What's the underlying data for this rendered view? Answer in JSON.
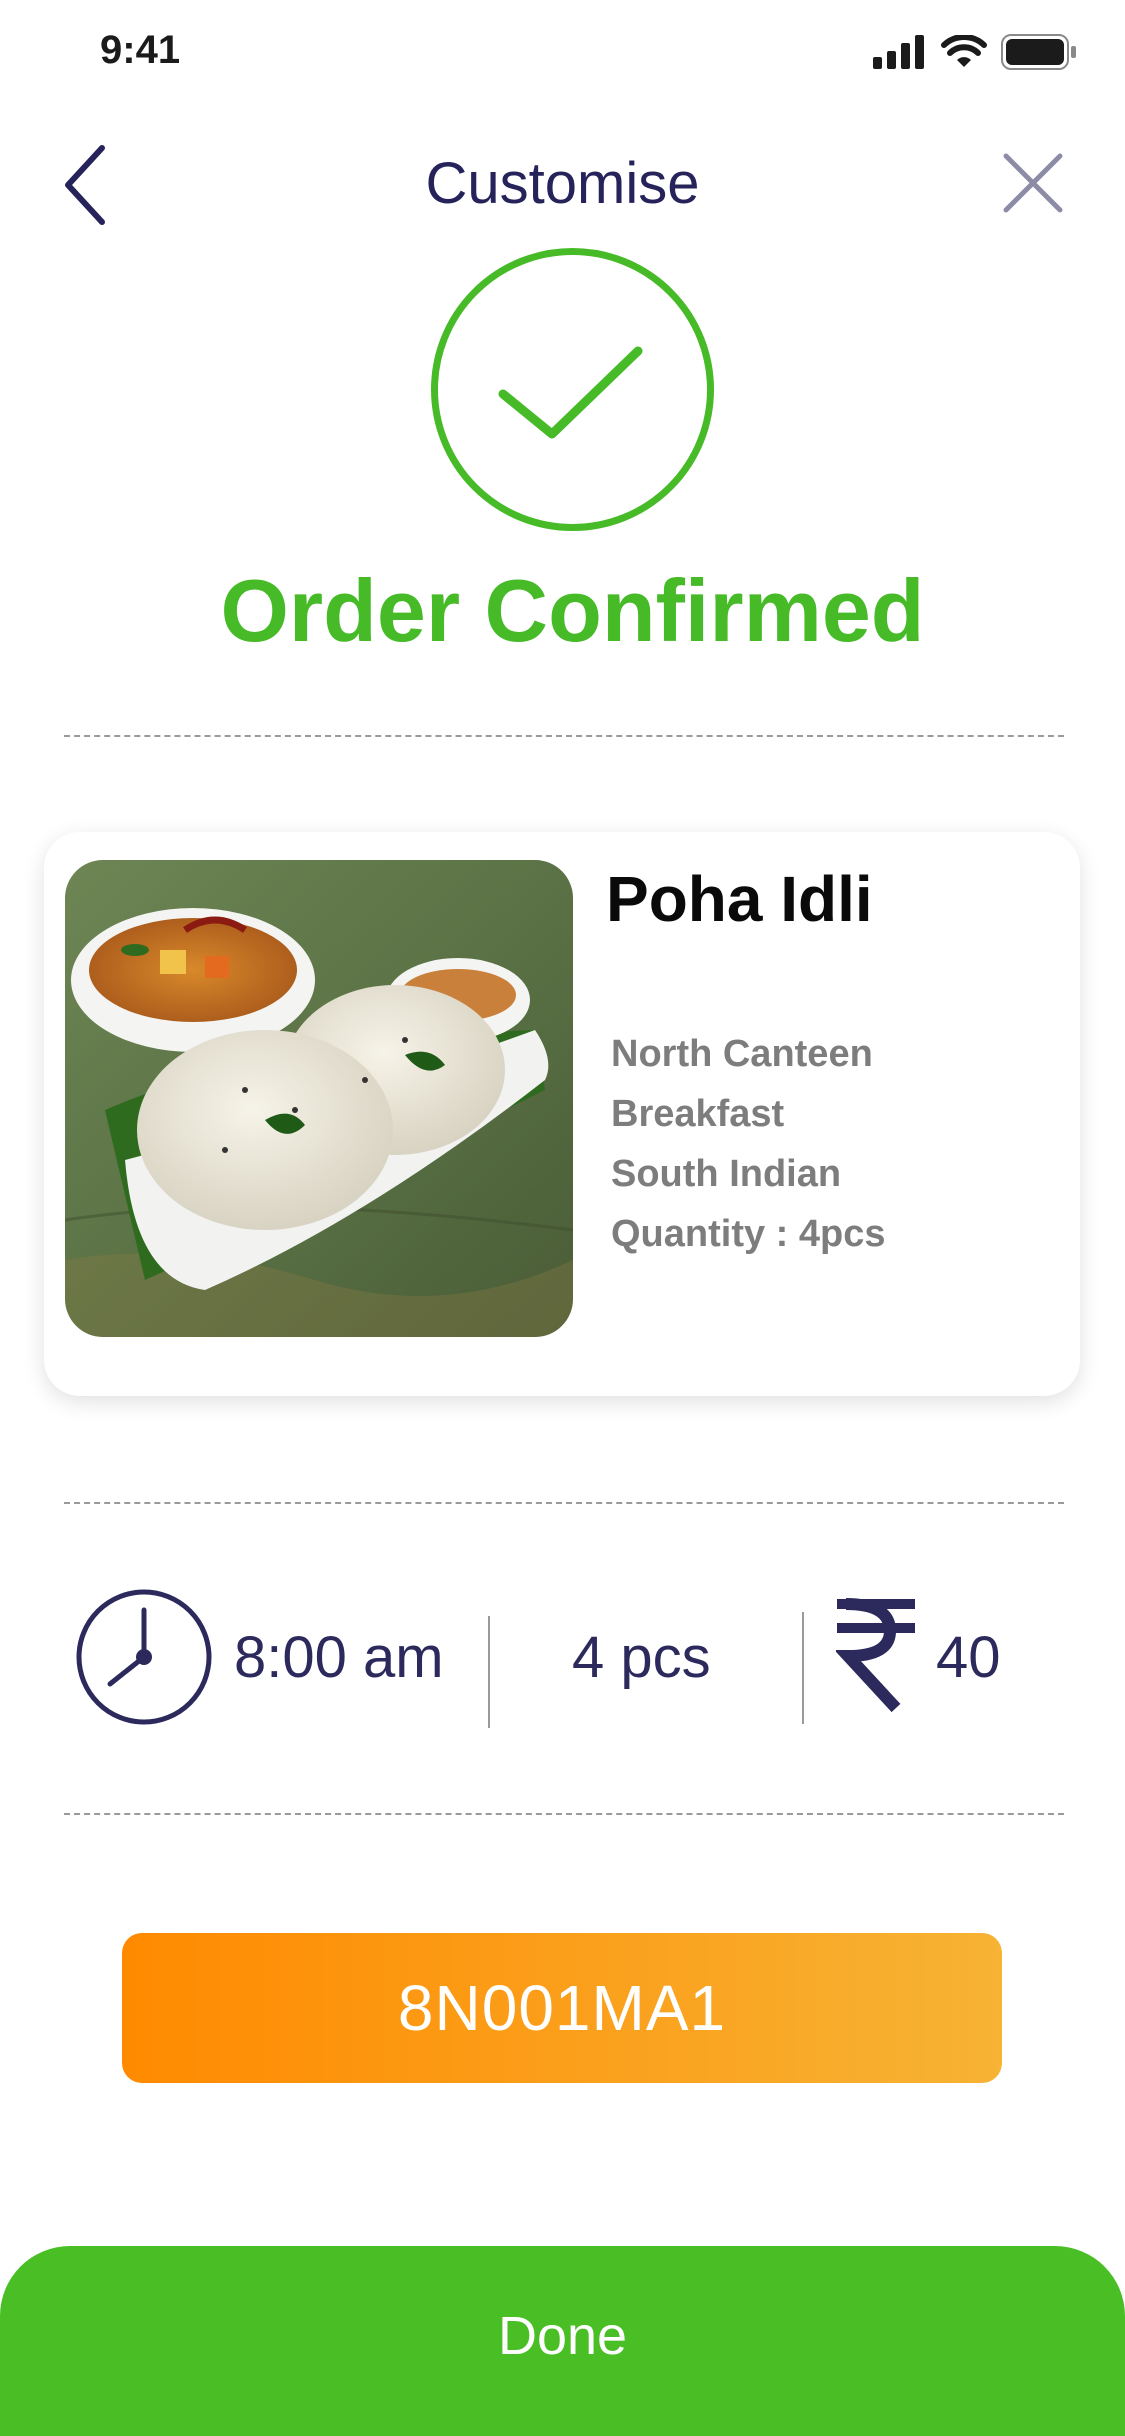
{
  "status_bar": {
    "time": "9:41"
  },
  "header": {
    "title": "Customise",
    "back_icon": "chevron-left-icon",
    "close_icon": "close-icon"
  },
  "confirmation": {
    "icon": "check-circle-icon",
    "title": "Order Confirmed",
    "color": "#46bb27"
  },
  "item": {
    "name": "Poha Idli",
    "details": [
      "North Canteen",
      "Breakfast",
      "South Indian",
      "Quantity : 4pcs"
    ]
  },
  "summary": {
    "time": "8:00 am",
    "quantity": "4 pcs",
    "price": "40",
    "currency_icon": "rupee-icon",
    "time_icon": "clock-icon"
  },
  "order_code": "8N001MA1",
  "done_label": "Done",
  "colors": {
    "accent_green": "#46bb27",
    "orange_start": "#ff8a00",
    "orange_end": "#f7b334",
    "text_dark": "#25235a"
  }
}
